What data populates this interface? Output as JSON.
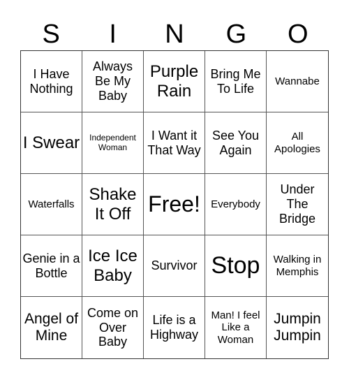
{
  "header": {
    "letters": [
      "S",
      "I",
      "N",
      "G",
      "O"
    ]
  },
  "card": {
    "cells": [
      {
        "text": "I Have Nothing",
        "size": "fs-m"
      },
      {
        "text": "Always Be My Baby",
        "size": "fs-m"
      },
      {
        "text": "Purple Rain",
        "size": "fs-xl"
      },
      {
        "text": "Bring Me To Life",
        "size": "fs-m"
      },
      {
        "text": "Wannabe",
        "size": "fs-s"
      },
      {
        "text": "I Swear",
        "size": "fs-xl"
      },
      {
        "text": "Independent Woman",
        "size": "fs-xs"
      },
      {
        "text": "I Want it That Way",
        "size": "fs-m"
      },
      {
        "text": "See You Again",
        "size": "fs-m"
      },
      {
        "text": "All Apologies",
        "size": "fs-s"
      },
      {
        "text": "Waterfalls",
        "size": "fs-s"
      },
      {
        "text": "Shake It Off",
        "size": "fs-xl"
      },
      {
        "text": "Free!",
        "size": "fs-xxl"
      },
      {
        "text": "Everybody",
        "size": "fs-s"
      },
      {
        "text": "Under The Bridge",
        "size": "fs-m"
      },
      {
        "text": "Genie in a Bottle",
        "size": "fs-m"
      },
      {
        "text": "Ice Ice Baby",
        "size": "fs-xl"
      },
      {
        "text": "Survivor",
        "size": "fs-m"
      },
      {
        "text": "Stop",
        "size": "fs-huge"
      },
      {
        "text": "Walking in Memphis",
        "size": "fs-s"
      },
      {
        "text": "Angel of Mine",
        "size": "fs-l"
      },
      {
        "text": "Come on Over Baby",
        "size": "fs-m"
      },
      {
        "text": "Life is a Highway",
        "size": "fs-m"
      },
      {
        "text": "Man! I feel Like a Woman",
        "size": "fs-s"
      },
      {
        "text": "Jumpin Jumpin",
        "size": "fs-l"
      }
    ]
  }
}
